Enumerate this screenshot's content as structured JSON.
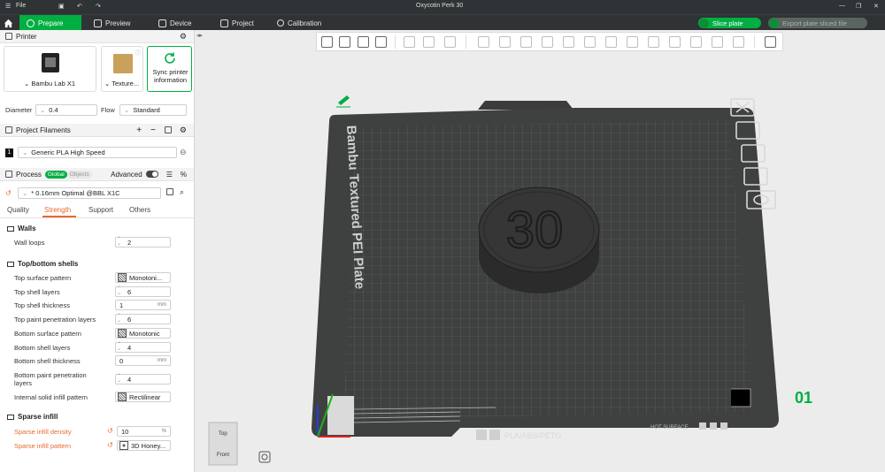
{
  "titlebar": {
    "menu_label": "File",
    "title": "Oxycotin Perk 30"
  },
  "tabs": [
    {
      "label": "Prepare"
    },
    {
      "label": "Preview"
    },
    {
      "label": "Device"
    },
    {
      "label": "Project"
    },
    {
      "label": "Calibration"
    }
  ],
  "actions": {
    "slice": "Slice plate",
    "export": "Export plate sliced file"
  },
  "printer": {
    "section_title": "Printer",
    "model": "Bambu Lab X1",
    "plate": "Texture...",
    "sync_label_1": "Sync printer",
    "sync_label_2": "information",
    "diameter_label": "Diameter",
    "diameter_value": "0.4",
    "flow_label": "Flow",
    "flow_value": "Standard"
  },
  "filaments": {
    "section_title": "Project Filaments",
    "items": [
      {
        "index": "1",
        "name": "Generic PLA High Speed"
      }
    ]
  },
  "process": {
    "section_title": "Process",
    "toggle_global": "Global",
    "toggle_objects": "Objects",
    "advanced_label": "Advanced",
    "profile": "* 0.16mm Optimal @BBL X1C",
    "tabs": [
      "Quality",
      "Strength",
      "Support",
      "Others"
    ],
    "active_tab": "Strength"
  },
  "settings": {
    "walls_title": "Walls",
    "wall_loops_label": "Wall loops",
    "wall_loops_value": "2",
    "shells_title": "Top/bottom shells",
    "top_surface_pattern_label": "Top surface pattern",
    "top_surface_pattern_value": "Monotoni...",
    "top_shell_layers_label": "Top shell layers",
    "top_shell_layers_value": "6",
    "top_shell_thickness_label": "Top shell thickness",
    "top_shell_thickness_value": "1",
    "top_paint_label": "Top paint penetration layers",
    "top_paint_value": "6",
    "bottom_surface_pattern_label": "Bottom surface pattern",
    "bottom_surface_pattern_value": "Monotonic",
    "bottom_shell_layers_label": "Bottom shell layers",
    "bottom_shell_layers_value": "4",
    "bottom_shell_thickness_label": "Bottom shell thickness",
    "bottom_shell_thickness_value": "0",
    "bottom_paint_label_1": "Bottom paint penetration",
    "bottom_paint_label_2": "layers",
    "bottom_paint_value": "4",
    "internal_pattern_label": "Internal solid infill pattern",
    "internal_pattern_value": "Rectilinear",
    "infill_title": "Sparse infill",
    "density_label": "Sparse infill density",
    "density_value": "10",
    "pattern_label": "Sparse infill pattern",
    "pattern_value": "3D Honey...",
    "unit_mm": "mm",
    "unit_pct": "%"
  },
  "viewport": {
    "plate_text": "Bambu Textured PEI Plate",
    "plate_number": "01",
    "model_text": "30",
    "plate_label": "PLA/ABS/PETG",
    "hot_surface": "HOT SURFACE",
    "cube_top": "Top",
    "cube_front": "Front"
  },
  "colors": {
    "accent": "#00ae42",
    "highlight": "#e86a2c",
    "dark_bar": "#2f3335"
  }
}
